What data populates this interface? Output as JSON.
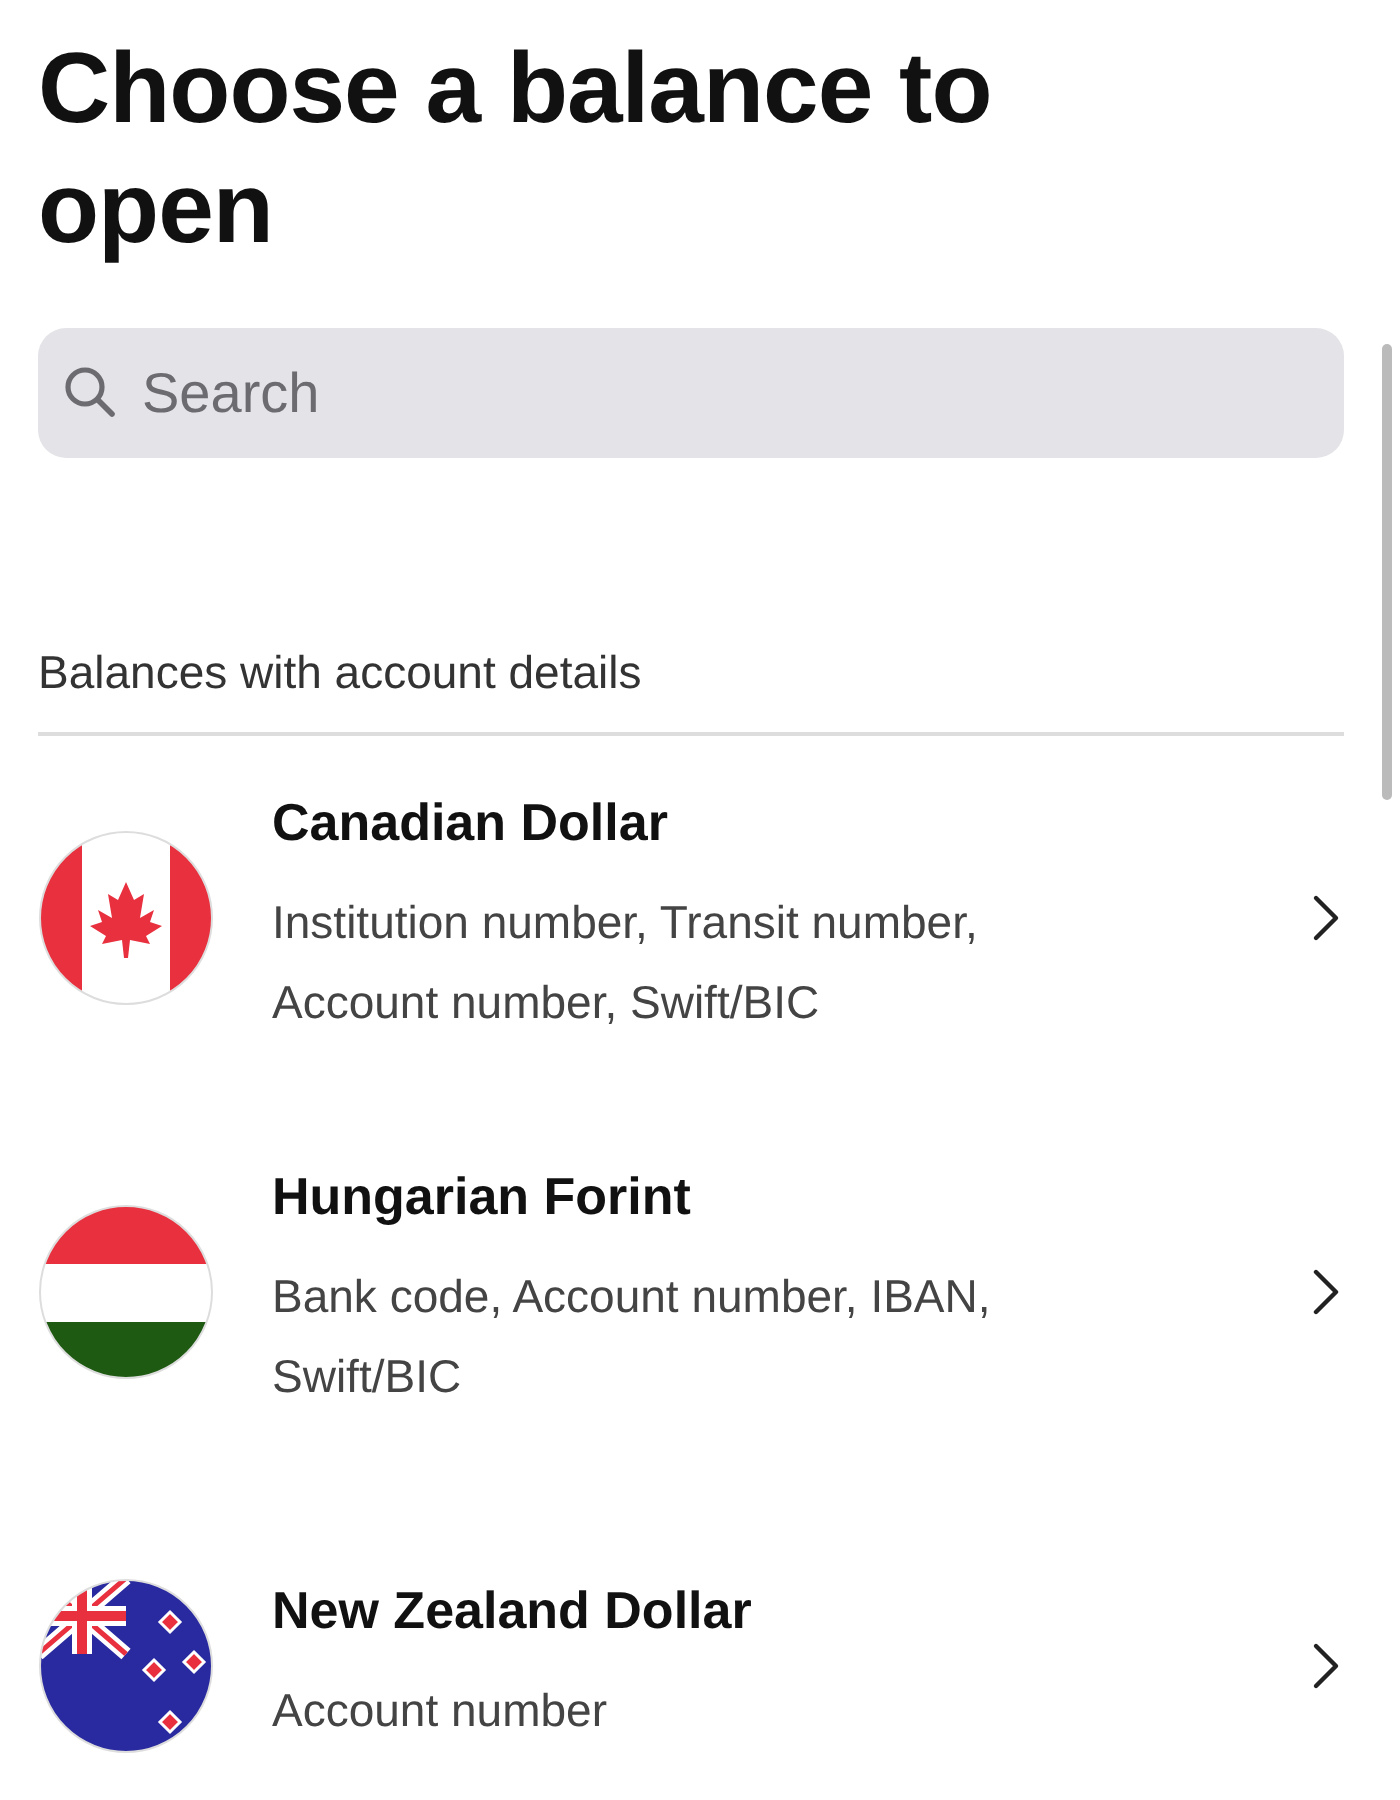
{
  "title": "Choose a balance to open",
  "search": {
    "placeholder": "Search"
  },
  "section": {
    "heading": "Balances with account details"
  },
  "balances": [
    {
      "kind": "canada",
      "name": "Canadian Dollar",
      "details": "Institution number, Transit number, Account number, Swift/BIC"
    },
    {
      "kind": "hungary",
      "name": "Hungarian Forint",
      "details": "Bank code, Account number, IBAN, Swift/BIC"
    },
    {
      "kind": "newzealand",
      "name": "New Zealand Dollar",
      "details": "Account number"
    }
  ]
}
